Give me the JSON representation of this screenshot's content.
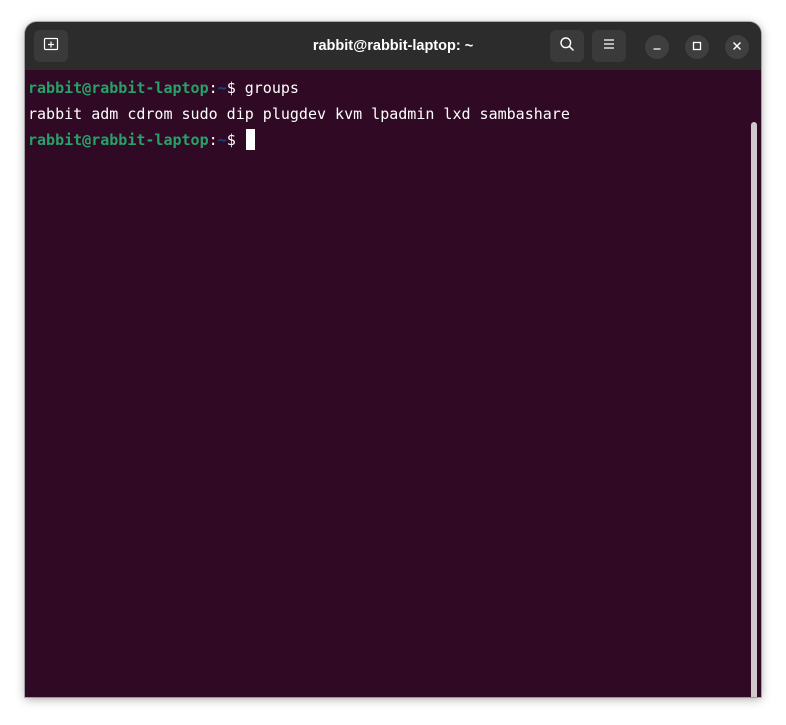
{
  "window": {
    "title": "rabbit@rabbit-laptop: ~"
  },
  "header": {
    "new_tab_icon": "new-tab-icon",
    "search_icon": "search-icon",
    "menu_icon": "hamburger-menu-icon",
    "minimize_icon": "minimize-icon",
    "maximize_icon": "maximize-icon",
    "close_icon": "close-icon"
  },
  "terminal": {
    "lines": [
      {
        "user_host": "rabbit@rabbit-laptop",
        "separator": ":",
        "path": "~",
        "prompt": "$ ",
        "command": "groups"
      },
      {
        "output": "rabbit adm cdrom sudo dip plugdev kvm lpadmin lxd sambashare"
      },
      {
        "user_host": "rabbit@rabbit-laptop",
        "separator": ":",
        "path": "~",
        "prompt": "$ ",
        "command": ""
      }
    ]
  },
  "colors": {
    "background": "#300a24",
    "titlebar": "#2c2c2c",
    "user_host": "#26a269",
    "path": "#12488b",
    "text": "#ffffff"
  }
}
